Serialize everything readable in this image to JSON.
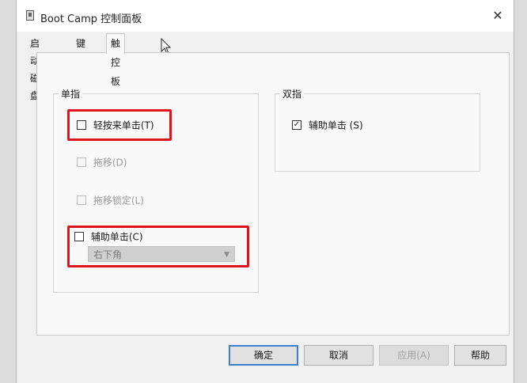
{
  "window": {
    "title": "Boot Camp 控制面板",
    "close_symbol": "✕"
  },
  "tabs": [
    {
      "label": "启动磁盘",
      "active": false
    },
    {
      "label": "键盘",
      "active": false
    },
    {
      "label": "触控板",
      "active": true
    }
  ],
  "single_finger": {
    "title": "单指",
    "tap_to_click": {
      "label": "轻按来单击(T)",
      "checked": false,
      "enabled": true
    },
    "dragging": {
      "label": "拖移(D)",
      "checked": false,
      "enabled": false
    },
    "drag_lock": {
      "label": "拖移锁定(L)",
      "checked": false,
      "enabled": false
    },
    "secondary_click": {
      "label": "辅助单击(C)",
      "checked": false,
      "enabled": true
    },
    "corner_select": {
      "value": "右下角",
      "enabled": false
    }
  },
  "two_finger": {
    "title": "双指",
    "secondary_click": {
      "label": "辅助单击 (S)",
      "checked": true,
      "enabled": true
    }
  },
  "buttons": {
    "ok": "确定",
    "cancel": "取消",
    "apply": "应用(A)",
    "help": "帮助"
  },
  "colors": {
    "highlight": "#e0141e",
    "primary_button_border": "#3c7fd1"
  }
}
